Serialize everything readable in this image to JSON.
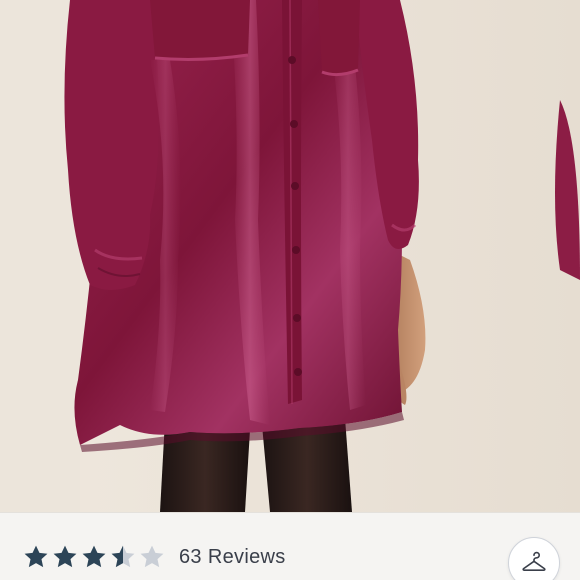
{
  "listing": {
    "photo_alt": "",
    "rating": {
      "value": 3.5,
      "max": 5,
      "stars": [
        "full",
        "full",
        "full",
        "half",
        "empty"
      ],
      "count": "63",
      "label": "Reviews"
    },
    "action_icon": "hanger-icon"
  },
  "colors": {
    "star_filled": "#2c4457",
    "star_empty": "#c9ced6",
    "text": "#3a3f4a",
    "dress": "#8e1c44",
    "background": "#ede6dc"
  }
}
